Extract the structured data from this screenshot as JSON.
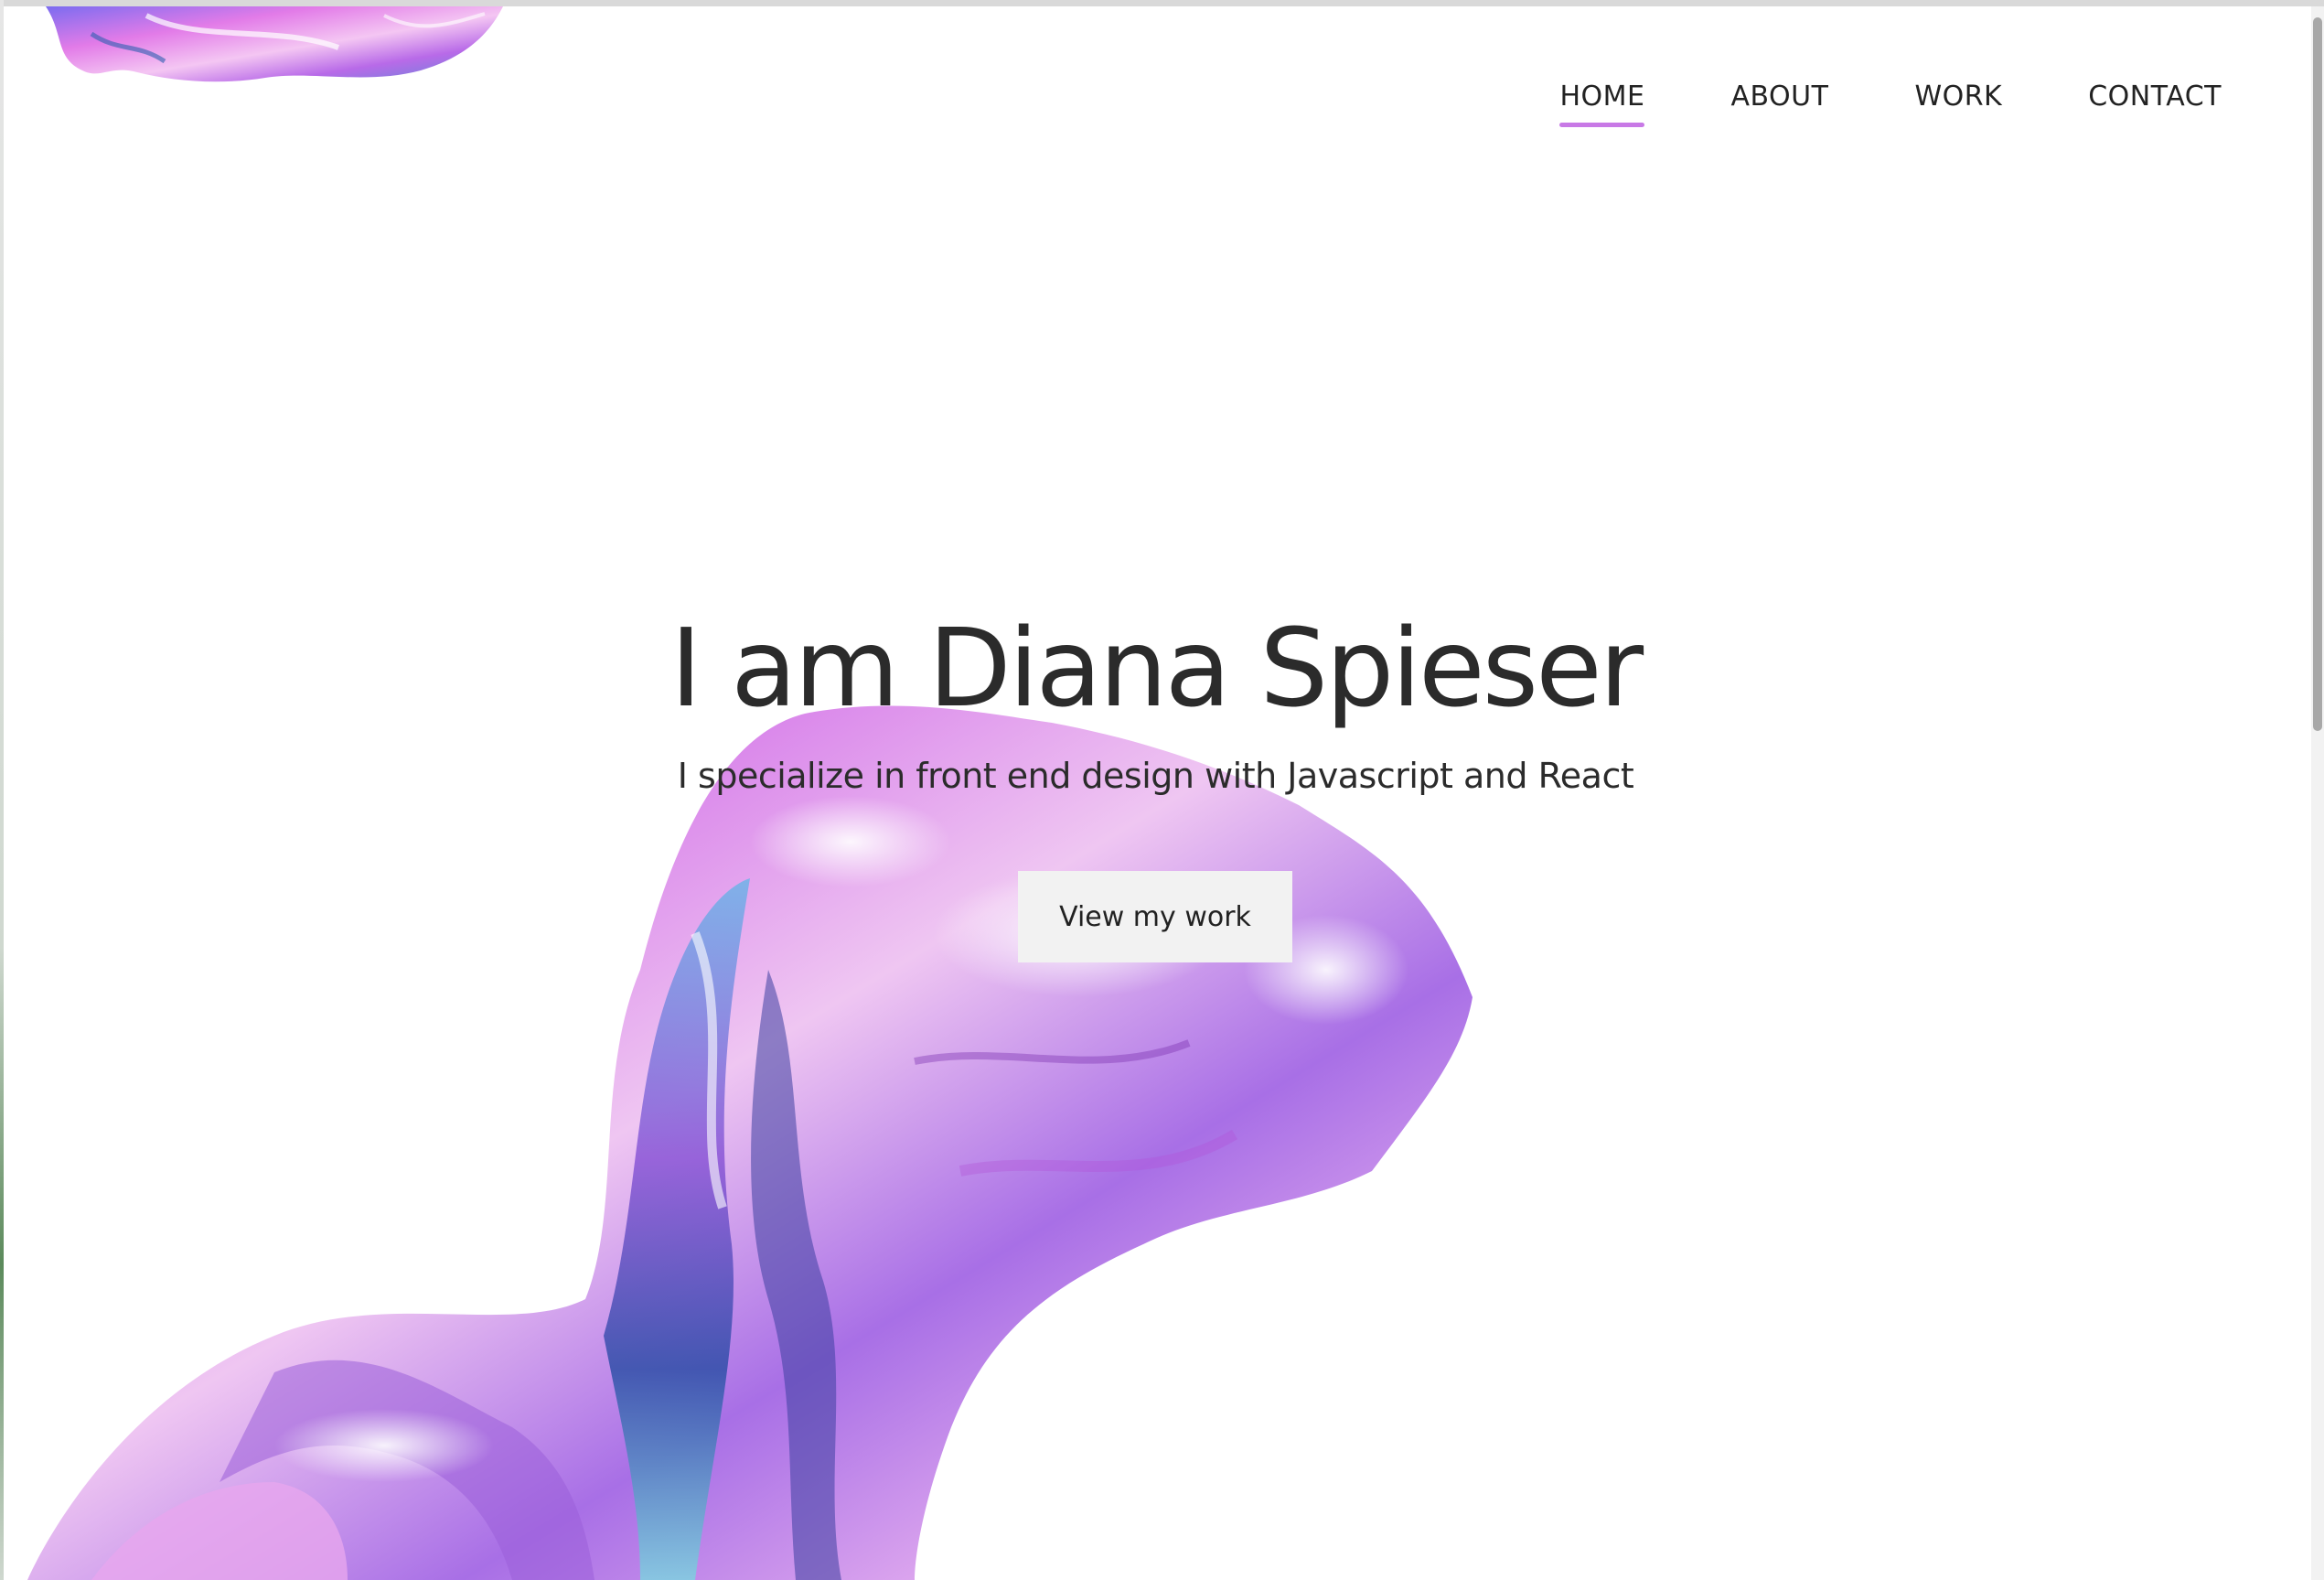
{
  "nav": {
    "items": [
      {
        "label": "HOME",
        "active": true
      },
      {
        "label": "ABOUT",
        "active": false
      },
      {
        "label": "WORK",
        "active": false
      },
      {
        "label": "CONTACT",
        "active": false
      }
    ]
  },
  "hero": {
    "title": "I am Diana Spieser",
    "subtitle": "I specialize in front end design with Javascript and React",
    "cta_label": "View my work"
  },
  "colors": {
    "accent": "#c879e6",
    "text": "#2b2b2b",
    "button_bg": "#f2f2f2"
  }
}
